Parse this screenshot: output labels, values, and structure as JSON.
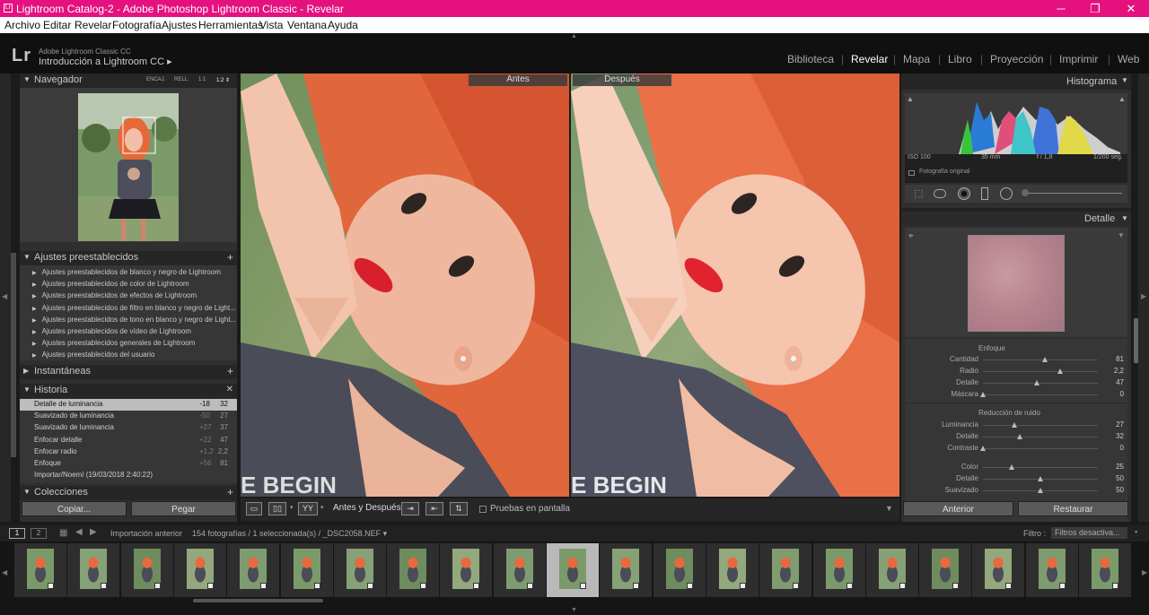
{
  "window": {
    "title": "Lightroom Catalog-2 - Adobe Photoshop Lightroom Classic - Revelar",
    "minimize": "─",
    "maximize": "❐",
    "close": "✕"
  },
  "menu": [
    "Archivo",
    "Editar",
    "Revelar",
    "Fotografía",
    "Ajustes",
    "Herramientas",
    "Vista",
    "Ventana",
    "Ayuda"
  ],
  "identity": {
    "logo": "Lr",
    "product": "Adobe Lightroom Classic CC",
    "subtitle": "Introducción a Lightroom CC ▸"
  },
  "modules": [
    {
      "label": "Biblioteca",
      "active": false
    },
    {
      "label": "Revelar",
      "active": true
    },
    {
      "label": "Mapa",
      "active": false
    },
    {
      "label": "Libro",
      "active": false
    },
    {
      "label": "Proyección",
      "active": false
    },
    {
      "label": "Imprimir",
      "active": false
    },
    {
      "label": "Web",
      "active": false
    }
  ],
  "navigator": {
    "title": "Navegador",
    "zoom": [
      "ENCAJ.",
      "RELL.",
      "1:1",
      "1:2 ⇕"
    ]
  },
  "presets": {
    "title": "Ajustes preestablecidos",
    "items": [
      "Ajustes preestablecidos de blanco y negro de Lightroom",
      "Ajustes preestablecidos de color de Lightroom",
      "Ajustes preestablecidos de efectos de Lightroom",
      "Ajustes preestablecidos de filtro en blanco y negro de Light...",
      "Ajustes preestablecidos de tono en blanco y negro de Light...",
      "Ajustes preestablecidos de vídeo de Lightroom",
      "Ajustes preestablecidos generales de Lightroom",
      "Ajustes preestablecidos del usuario"
    ]
  },
  "snapshots": {
    "title": "Instantáneas"
  },
  "history": {
    "title": "Historia",
    "items": [
      {
        "name": "Detalle de luminancia",
        "delta": "-18",
        "value": "32",
        "selected": true
      },
      {
        "name": "Suavizado de luminancia",
        "delta": "-50",
        "value": "27",
        "selected": false
      },
      {
        "name": "Suavizado de luminancia",
        "delta": "+27",
        "value": "37",
        "selected": false
      },
      {
        "name": "Enfocar detalle",
        "delta": "+22",
        "value": "47",
        "selected": false
      },
      {
        "name": "Enfocar radio",
        "delta": "+1,2",
        "value": "2,2",
        "selected": false
      },
      {
        "name": "Enfoque",
        "delta": "+56",
        "value": "81",
        "selected": false
      },
      {
        "name": "Importar/Noemí (19/03/2018 2:40:22)",
        "delta": "",
        "value": "",
        "selected": false
      }
    ]
  },
  "collections": {
    "title": "Colecciones"
  },
  "left_buttons": {
    "copy": "Copiar...",
    "paste": "Pegar"
  },
  "view": {
    "before": "Antes",
    "after": "Después"
  },
  "toolbar": {
    "before_after_label": "Antes y Después:",
    "yy": "YY",
    "proof_label": "Pruebas en pantalla"
  },
  "histogram": {
    "title": "Histograma",
    "iso": "ISO 100",
    "focal": "35 mm",
    "aperture": "f / 1,8",
    "shutter": "1/200 seg.",
    "original_label": "Fotografía original"
  },
  "detail": {
    "title": "Detalle",
    "sharpening_title": "Enfoque",
    "sharpening": [
      {
        "name": "Cantidad",
        "value": "81",
        "level": 0.54
      },
      {
        "name": "Radio",
        "value": "2,2",
        "level": 0.67
      },
      {
        "name": "Detalle",
        "value": "47",
        "level": 0.47
      },
      {
        "name": "Máscara",
        "value": "0",
        "level": 0.0
      }
    ],
    "noise_title": "Reducción de ruido",
    "noise": [
      {
        "name": "Luminancia",
        "value": "27",
        "level": 0.27
      },
      {
        "name": "Detalle",
        "value": "32",
        "level": 0.32
      },
      {
        "name": "Contraste",
        "value": "0",
        "level": 0.0
      }
    ],
    "color": [
      {
        "name": "Color",
        "value": "25",
        "level": 0.25
      },
      {
        "name": "Detalle",
        "value": "50",
        "level": 0.5
      },
      {
        "name": "Suavizado",
        "value": "50",
        "level": 0.5
      }
    ]
  },
  "right_buttons": {
    "previous": "Anterior",
    "reset": "Restaurar"
  },
  "filmstrip": {
    "view1": "1",
    "view2": "2",
    "source": "Importación anterior",
    "count": "154 fotografías / 1 seleccionada(s) / _DSC2058.NEF ▾",
    "filter_label": "Filtro :",
    "filter_value": "Filtros desactiva...",
    "thumb_count": 21,
    "selected_index": 10
  },
  "colors": {
    "title_bar": "#e5117f",
    "hair": "#e8633a",
    "skin": "#f0b49a",
    "lips": "#e0232f",
    "shirt": "#4a4c58"
  }
}
